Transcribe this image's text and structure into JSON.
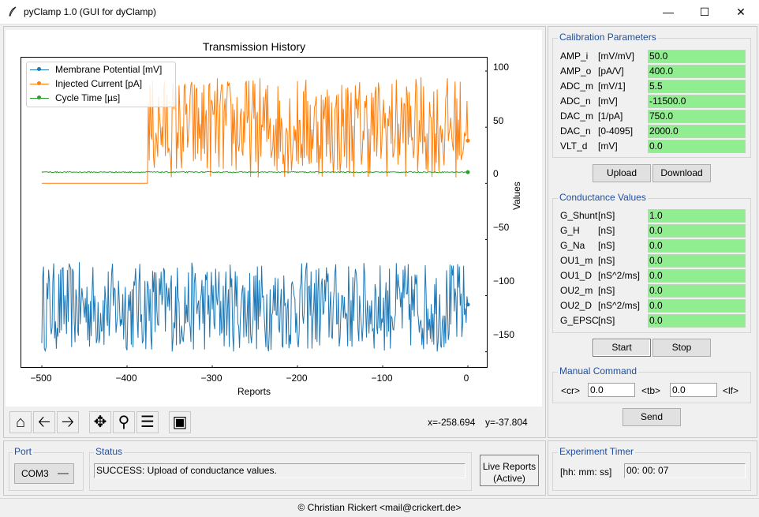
{
  "window": {
    "title": "pyClamp 1.0 (GUI for dyClamp)",
    "minimize_icon": "minimize-icon",
    "maximize_icon": "maximize-icon",
    "close_icon": "close-icon"
  },
  "plot": {
    "toolbar": {
      "buttons": [
        "home-icon",
        "back-arrow-icon",
        "forward-arrow-icon",
        "pan-icon",
        "zoom-icon",
        "configure-icon",
        "save-icon"
      ]
    },
    "coords": {
      "x": "x=-258.694",
      "y": "y=-37.804"
    }
  },
  "chart_data": {
    "type": "line",
    "title": "Transmission History",
    "xlabel": "Reports",
    "ylabel": "Values",
    "xlim": [
      -500,
      0
    ],
    "ylim": [
      -165,
      112
    ],
    "x_ticks": [
      "−500",
      "−400",
      "−300",
      "−200",
      "−100",
      "0"
    ],
    "y_ticks": [
      "100",
      "50",
      "0",
      "−50",
      "−100",
      "−150"
    ],
    "y_axis_side": "right",
    "legend_position": "top-left",
    "grid": false,
    "series": [
      {
        "name": "Membrane Potential [mV]",
        "color": "#1f77b4",
        "pattern": "noise",
        "mean": -110,
        "amplitude": 40,
        "x_start": -500,
        "x_end": 0,
        "last_value": -108
      },
      {
        "name": "Injected Current [pA]",
        "color": "#ff7f0e",
        "pattern": "step-noise",
        "pre_value": 0,
        "step_x": -375,
        "mean": 50,
        "amplitude": 45,
        "x_start": -500,
        "x_end": 0,
        "last_value": 38
      },
      {
        "name": "Cycle Time [µs]",
        "color": "#2ca02c",
        "pattern": "flat",
        "mean": 10,
        "amplitude": 1,
        "x_start": -500,
        "x_end": 0,
        "last_value": 10
      }
    ]
  },
  "calibration": {
    "title": "Calibration Parameters",
    "rows": [
      {
        "name": "AMP_i",
        "unit": "[mV/mV]",
        "value": "50.0"
      },
      {
        "name": "AMP_o",
        "unit": "[pA/V]",
        "value": "400.0"
      },
      {
        "name": "ADC_m",
        "unit": "[mV/1]",
        "value": "5.5"
      },
      {
        "name": "ADC_n",
        "unit": "[mV]",
        "value": "-11500.0"
      },
      {
        "name": "DAC_m",
        "unit": "[1/pA]",
        "value": "750.0"
      },
      {
        "name": "DAC_n",
        "unit": "[0-4095]",
        "value": "2000.0"
      },
      {
        "name": "VLT_d",
        "unit": "[mV]",
        "value": "0.0"
      }
    ],
    "upload_label": "Upload",
    "download_label": "Download"
  },
  "conductance": {
    "title": "Conductance Values",
    "rows": [
      {
        "name": "G_Shunt",
        "unit": "[nS]",
        "value": "1.0"
      },
      {
        "name": "G_H",
        "unit": "[nS]",
        "value": "0.0"
      },
      {
        "name": "G_Na",
        "unit": "[nS]",
        "value": "0.0"
      },
      {
        "name": "OU1_m",
        "unit": "[nS]",
        "value": "0.0"
      },
      {
        "name": "OU1_D",
        "unit": "[nS^2/ms]",
        "value": "0.0"
      },
      {
        "name": "OU2_m",
        "unit": "[nS]",
        "value": "0.0"
      },
      {
        "name": "OU2_D",
        "unit": "[nS^2/ms]",
        "value": "0.0"
      },
      {
        "name": "G_EPSC",
        "unit": "[nS]",
        "value": "0.0"
      }
    ],
    "start_label": "Start",
    "stop_label": "Stop"
  },
  "manual": {
    "title": "Manual Command",
    "cr_label": "<cr>",
    "tb_label": "<tb>",
    "lf_label": "<lf>",
    "value1": "0.0",
    "value2": "0.0",
    "send_label": "Send"
  },
  "port": {
    "title": "Port",
    "selected": "COM3"
  },
  "status": {
    "title": "Status",
    "text": "SUCCESS: Upload of conductance values."
  },
  "live_reports": {
    "line1": "Live Reports",
    "line2": "(Active)"
  },
  "timer": {
    "title": "Experiment Timer",
    "format": "[hh: mm: ss]",
    "value": "00: 00: 07"
  },
  "footer": {
    "text": "© Christian Rickert <mail@crickert.de>"
  }
}
